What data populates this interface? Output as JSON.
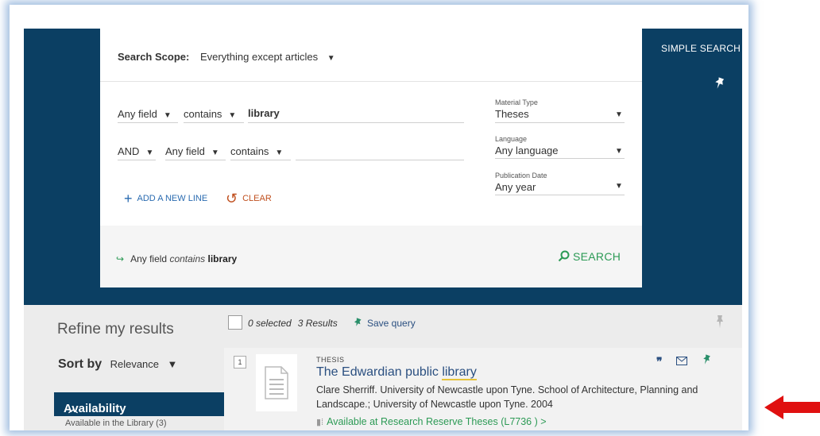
{
  "header": {
    "simple_search": "SIMPLE SEARCH"
  },
  "scope": {
    "label": "Search Scope:",
    "value": "Everything except articles"
  },
  "query_rows": [
    {
      "field": "Any field",
      "op": "contains",
      "value": "library"
    },
    {
      "bool": "AND",
      "field": "Any field",
      "op": "contains",
      "value": ""
    }
  ],
  "actions": {
    "add_line": "ADD A NEW LINE",
    "clear": "CLEAR",
    "search": "SEARCH"
  },
  "filters": {
    "material_type": {
      "label": "Material Type",
      "value": "Theses"
    },
    "language": {
      "label": "Language",
      "value": "Any language"
    },
    "publication_date": {
      "label": "Publication Date",
      "value": "Any year"
    }
  },
  "summary": {
    "field": "Any field",
    "op": "contains",
    "value": "library"
  },
  "results_bar": {
    "selected": "0 selected",
    "count": "3 Results",
    "save_query": "Save query"
  },
  "sidebar": {
    "refine": "Refine my results",
    "sort_label": "Sort by",
    "sort_value": "Relevance",
    "availability": "Availability",
    "availability_sub": "Available in the Library  (3)"
  },
  "result": {
    "index": "1",
    "type": "THESIS",
    "title_prefix": "The Edwardian public ",
    "title_highlight": "library",
    "description": "Clare Sherriff. University of Newcastle upon Tyne. School of Architecture, Planning and Landscape.; University of Newcastle upon Tyne. 2004",
    "availability": "Available at Research Reserve  Theses (L7736 )  >"
  },
  "colors": {
    "header_bg": "#0b3f63",
    "accent_green": "#2c9a55",
    "link_blue": "#2a4f80",
    "arrow_red": "#e01010"
  }
}
